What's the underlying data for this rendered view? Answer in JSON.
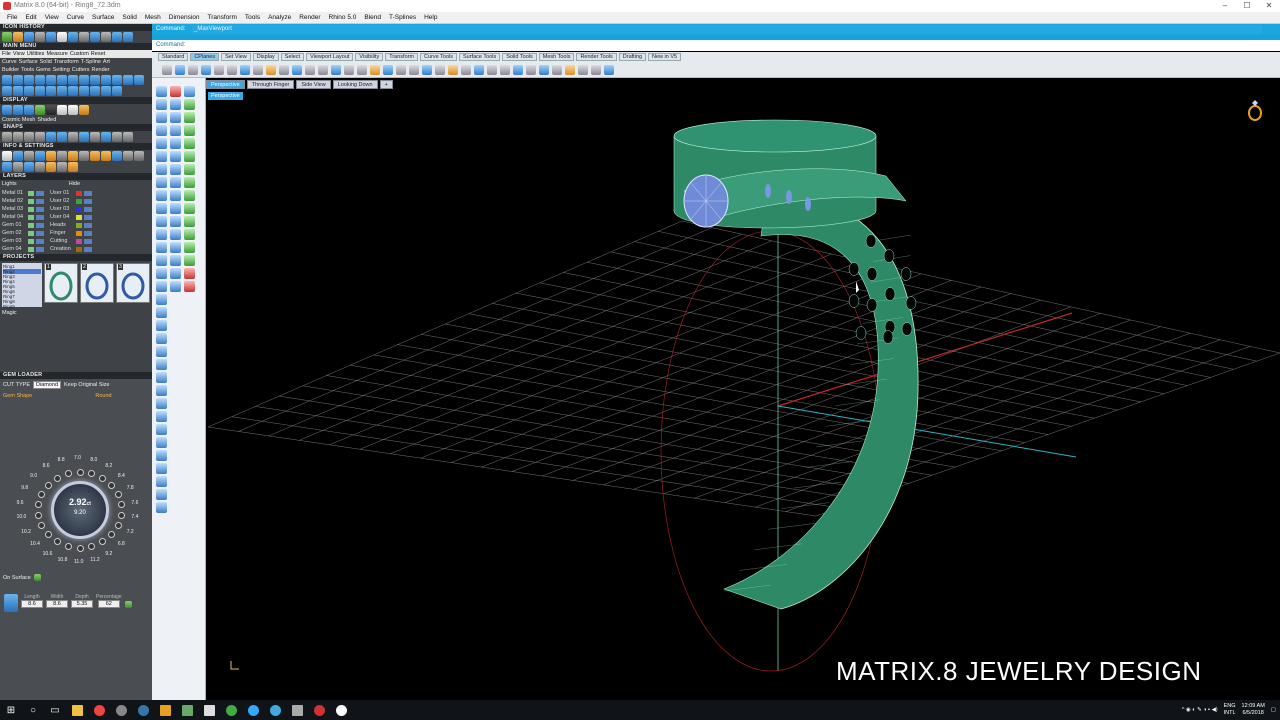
{
  "window": {
    "title": "Matrix 8.0 (64-bit) - Ring8_72.3dm",
    "controls": [
      "–",
      "☐",
      "✕"
    ]
  },
  "menubar": [
    "File",
    "Edit",
    "View",
    "Curve",
    "Surface",
    "Solid",
    "Mesh",
    "Dimension",
    "Transform",
    "Tools",
    "Analyze",
    "Render",
    "Rhino 5.0",
    "Blend",
    "T-Splines",
    "Help"
  ],
  "left_panel": {
    "icon_history": "ICON HISTORY",
    "main_menu": "MAIN MENU",
    "main_menu_items": [
      "File",
      "View",
      "Utilities",
      "Measure",
      "Custom",
      "Reset"
    ],
    "main_menu_row2": [
      "Curve",
      "Surface",
      "Solid",
      "Transform",
      "T-Spline",
      "Art"
    ],
    "main_menu_row3": [
      "Builder",
      "Tools",
      "Gems",
      "Setting",
      "Cutters",
      "Render"
    ],
    "display": "DISPLAY",
    "display_modes": [
      "Cosmic Mesh",
      "Shaded"
    ],
    "snaps": "SNAPS",
    "info_settings": "INFO & SETTINGS",
    "layers": "LAYERS",
    "layers_header": [
      "Lights",
      "Hide"
    ],
    "layers_left": [
      "Metal 01",
      "Metal 02",
      "Metal 03",
      "Metal 04",
      "Gem 01",
      "Gem 02",
      "Gem 03",
      "Gem 04"
    ],
    "layers_right": [
      "User 01",
      "User 02",
      "User 03",
      "User 04",
      "Heads",
      "Finger",
      "Cutting",
      "Creation"
    ],
    "projects": "PROJECTS",
    "project_list": [
      "Ring1",
      "Ring2",
      "Ring3",
      "Ring4",
      "Ring5",
      "Ring6",
      "Ring7",
      "Ring8",
      "Ring9"
    ],
    "project_thumbs": [
      "1",
      "2",
      "3"
    ],
    "magic": "Magic"
  },
  "gem_loader": {
    "title": "GEM LOADER",
    "cut_type_label": "CUT TYPE",
    "cut_type": "Diamond",
    "keep_original": "Keep Original Size",
    "gem_shape_label": "Gem Shape",
    "gem_shape": "Round",
    "carat": "2.92",
    "carat_unit": "ct",
    "size": "9.20",
    "dial_ticks": [
      "7.0",
      "8.0",
      "8.2",
      "8.4",
      "7.8",
      "7.6",
      "7.4",
      "7.2",
      "6.8",
      "9.2",
      "11.2",
      "11.0",
      "10.8",
      "10.6",
      "10.4",
      "10.2",
      "10.0",
      "9.6",
      "9.8",
      "9.0",
      "8.6",
      "8.8"
    ],
    "on_surface": "On Surface",
    "measure_labels": [
      "Length",
      "Width",
      "Depth",
      "Percentage"
    ],
    "measure_values": [
      "8.6",
      "8.6",
      "5.35",
      "62"
    ]
  },
  "command": {
    "label1": "Command:",
    "value1": "_MaxViewport",
    "label2": "Command:",
    "value2": ""
  },
  "toolbar_tabs": [
    "Standard",
    "CPlanes",
    "Set View",
    "Display",
    "Select",
    "Viewport Layout",
    "Visibility",
    "Transform",
    "Curve Tools",
    "Surface Tools",
    "Solid Tools",
    "Mesh Tools",
    "Render Tools",
    "Drafting",
    "New in V5"
  ],
  "toolbar_active": "CPlanes",
  "view_tabs": [
    "Perspective",
    "Through Finger",
    "Side View",
    "Looking Down"
  ],
  "view_tab_add": "+",
  "active_view": "Perspective",
  "viewport_label": "Perspective",
  "watermark": "MATRIX.8 JEWELRY DESIGN",
  "taskbar": {
    "lang_top": "ENG",
    "lang_bottom": "INTL",
    "time": "12:09 AM",
    "date": "6/5/2018"
  },
  "colors": {
    "ring": "#2e8a66",
    "grid": "#9a9a9a",
    "axis_x": "#c0282c",
    "axis_y": "#2fb2c6",
    "command_bar": "#1aa7e0"
  }
}
